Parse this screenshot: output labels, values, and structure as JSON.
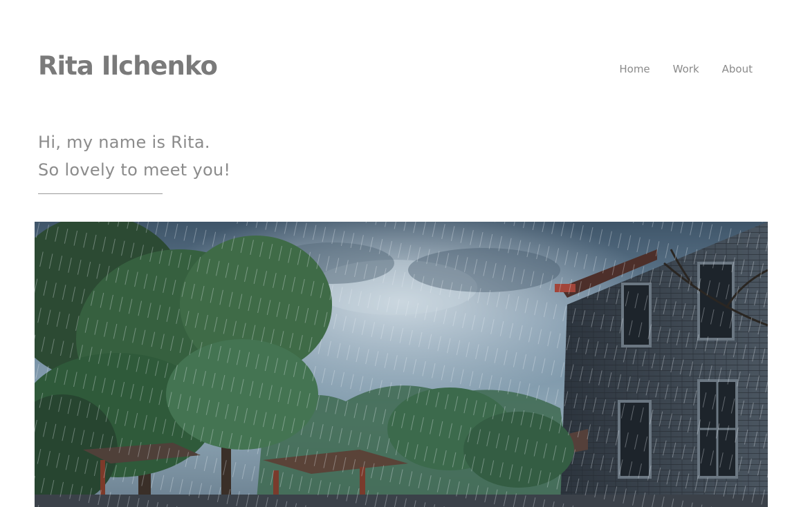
{
  "header": {
    "site_title": "Rita Ilchenko",
    "nav": [
      {
        "label": "Home"
      },
      {
        "label": "Work"
      },
      {
        "label": "About"
      }
    ]
  },
  "intro": {
    "line1": "Hi, my name is Rita.",
    "line2": "So lovely to meet you!"
  },
  "hero": {
    "scene": "rainy-village-street"
  },
  "colors": {
    "text": "#7a7a7a",
    "sky": "#6f8aa0",
    "foliage": "#2f5a3a",
    "brick": "#3a4450"
  }
}
